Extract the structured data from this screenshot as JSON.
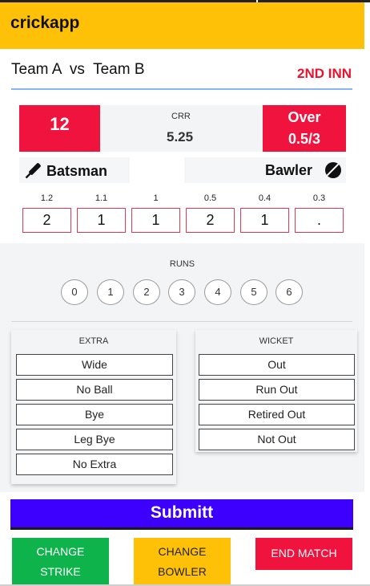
{
  "app": {
    "title": "crickapp"
  },
  "match": {
    "title": "Team A  vs  Team B",
    "innings": "2ND INN"
  },
  "score": {
    "runs": "12",
    "crr_label": "CRR",
    "crr_value": "5.25",
    "over_label": "Over",
    "over_value": "0.5/3"
  },
  "players": {
    "batsman_label": "Batsman",
    "bowler_label": "Bawler"
  },
  "balls": [
    {
      "label": "1.2",
      "value": "2"
    },
    {
      "label": "1.1",
      "value": "1"
    },
    {
      "label": "1",
      "value": "1"
    },
    {
      "label": "0.5",
      "value": "2"
    },
    {
      "label": "0.4",
      "value": "1"
    },
    {
      "label": "0.3",
      "value": "."
    }
  ],
  "runs": {
    "label": "RUNS",
    "options": [
      "0",
      "1",
      "2",
      "3",
      "4",
      "5",
      "6"
    ]
  },
  "extra": {
    "label": "EXTRA",
    "options": [
      "Wide",
      "No Ball",
      "Bye",
      "Leg Bye",
      "No Extra"
    ]
  },
  "wicket": {
    "label": "WICKET",
    "options": [
      "Out",
      "Run Out",
      "Retired Out",
      "Not Out"
    ]
  },
  "actions": {
    "submit": "Submitt",
    "change_strike_1": "CHANGE",
    "change_strike_2": "STRIKE",
    "change_bowler_1": "CHANGE",
    "change_bowler_2": "BOWLER",
    "end_match": "END MATCH"
  },
  "colors": {
    "appbar": "#ffc107",
    "accent_red": "#f0133d",
    "submit_blue": "#3d00ff",
    "green": "#0fb34b"
  }
}
